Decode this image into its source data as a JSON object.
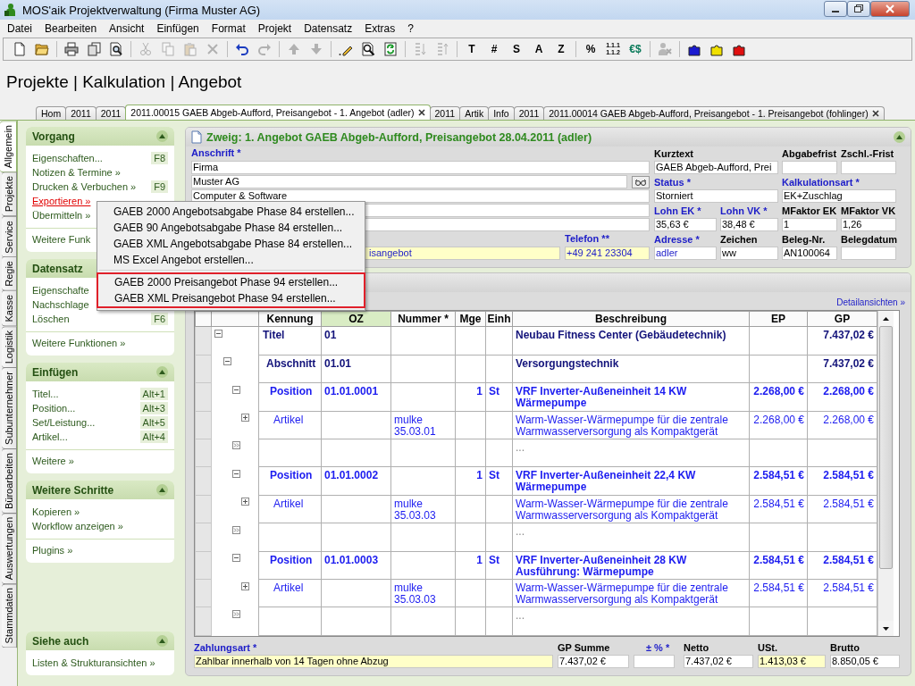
{
  "window": {
    "title": "MOS'aik Projektverwaltung (Firma Muster AG)"
  },
  "menu": [
    "Datei",
    "Bearbeiten",
    "Ansicht",
    "Einfügen",
    "Format",
    "Projekt",
    "Datensatz",
    "Extras",
    "?"
  ],
  "toolbar": [
    [
      {
        "kind": "icon",
        "disabled": false
      },
      {
        "kind": "icon",
        "disabled": false
      }
    ],
    [
      {
        "kind": "icon",
        "disabled": false
      },
      {
        "kind": "icon",
        "disabled": false
      },
      {
        "kind": "icon",
        "disabled": false
      }
    ],
    [
      {
        "kind": "icon",
        "disabled": true
      },
      {
        "kind": "icon",
        "disabled": true
      },
      {
        "kind": "icon",
        "disabled": true
      },
      {
        "kind": "icon",
        "disabled": true
      }
    ],
    [
      {
        "kind": "icon",
        "disabled": false
      },
      {
        "kind": "icon",
        "disabled": true
      }
    ],
    [
      {
        "kind": "icon",
        "disabled": true
      },
      {
        "kind": "icon",
        "disabled": true
      }
    ],
    [
      {
        "kind": "icon",
        "disabled": false
      },
      {
        "kind": "icon",
        "disabled": false
      },
      {
        "kind": "icon",
        "disabled": false
      }
    ],
    [
      {
        "kind": "icon",
        "disabled": true
      },
      {
        "kind": "icon",
        "disabled": true
      }
    ],
    [
      {
        "kind": "text",
        "label": "T"
      },
      {
        "kind": "text",
        "label": "#"
      },
      {
        "kind": "text",
        "label": "S"
      },
      {
        "kind": "text",
        "label": "A"
      },
      {
        "kind": "text",
        "label": "Z"
      }
    ],
    [
      {
        "kind": "text",
        "label": "%"
      },
      {
        "kind": "stack",
        "lines": [
          "1.1.1",
          "1.1.2"
        ]
      },
      {
        "kind": "currency",
        "label": "€$"
      }
    ],
    [
      {
        "kind": "icon",
        "disabled": true
      }
    ],
    [
      {
        "kind": "puzzle",
        "color": "#1a1ad0"
      },
      {
        "kind": "puzzle",
        "color": "#f0e000"
      },
      {
        "kind": "puzzle",
        "color": "#e01010"
      }
    ]
  ],
  "breadcrumb": "Projekte | Kalkulation | Angebot",
  "doc_tabs": [
    {
      "label": "Hom",
      "selected": false,
      "closable": false
    },
    {
      "label": "2011",
      "selected": false,
      "closable": false
    },
    {
      "label": "2011",
      "selected": false,
      "closable": false
    },
    {
      "label": "2011.00015 GAEB Abgeb-Aufford, Preisangebot - 1. Angebot (adler)",
      "selected": true,
      "closable": true
    },
    {
      "label": "2011",
      "selected": false,
      "closable": false
    },
    {
      "label": "Artik",
      "selected": false,
      "closable": false
    },
    {
      "label": "Info",
      "selected": false,
      "closable": false
    },
    {
      "label": "2011",
      "selected": false,
      "closable": false
    },
    {
      "label": "2011.00014 GAEB Abgeb-Aufford, Preisangebot - 1. Preisangebot (fohlinger)",
      "selected": false,
      "closable": true
    }
  ],
  "side_tabs": [
    {
      "label": "Allgemein",
      "selected": true
    },
    {
      "label": "Projekte",
      "selected": false
    },
    {
      "label": "Service",
      "selected": false
    },
    {
      "label": "Regie",
      "selected": false
    },
    {
      "label": "Kasse",
      "selected": false
    },
    {
      "label": "Logistik",
      "selected": false
    },
    {
      "label": "Subunternehmer",
      "selected": false
    },
    {
      "label": "Büroarbeiten",
      "selected": false
    },
    {
      "label": "Auswertungen",
      "selected": false
    },
    {
      "label": "Stammdaten",
      "selected": false
    }
  ],
  "sidebar": [
    {
      "title": "Vorgang",
      "collapse_button": true,
      "items": [
        {
          "label": "Eigenschaften...",
          "shortcut": "F8",
          "highlighted": false
        },
        {
          "label": "Notizen & Termine »",
          "highlighted": false
        },
        {
          "label": "Drucken & Verbuchen »",
          "shortcut": "F9",
          "highlighted": false
        },
        {
          "label": "Exportieren »",
          "highlighted": true
        },
        {
          "label": "Übermitteln »",
          "highlighted": false
        }
      ],
      "extra": [
        "Weitere Funk"
      ]
    },
    {
      "title": "Datensatz",
      "collapse_button": false,
      "items": [
        {
          "label": "Eigenschafte",
          "highlighted": false
        },
        {
          "label": "Nachschlage",
          "highlighted": false
        },
        {
          "label": "Löschen",
          "shortcut": "F6",
          "highlighted": false
        }
      ],
      "extra": [
        "Weitere Funktionen »"
      ]
    },
    {
      "title": "Einfügen",
      "collapse_button": true,
      "items": [
        {
          "label": "Titel...",
          "shortcut": "Alt+1",
          "highlighted": false
        },
        {
          "label": "Position...",
          "shortcut": "Alt+3",
          "highlighted": false
        },
        {
          "label": "Set/Leistung...",
          "shortcut": "Alt+5",
          "highlighted": false
        },
        {
          "label": "Artikel...",
          "shortcut": "Alt+4",
          "highlighted": false
        }
      ],
      "extra": [
        "Weitere »"
      ]
    },
    {
      "title": "Weitere Schritte",
      "collapse_button": true,
      "items": [
        {
          "label": "Kopieren »",
          "highlighted": false
        },
        {
          "label": "Workflow anzeigen »",
          "highlighted": false
        }
      ],
      "extra": [
        "Plugins »"
      ]
    },
    {
      "title": "Siehe auch",
      "collapse_button": true,
      "items": [
        {
          "label": "Listen & Strukturansichten »",
          "highlighted": false
        }
      ]
    }
  ],
  "branch": {
    "title": "Zweig: 1. Angebot GAEB Abgeb-Aufford, Preisangebot 28.04.2011 (adler)",
    "address_label": {
      "label": "Anschrift *",
      "required": true
    },
    "address_lines": [
      {
        "kind": "plain",
        "value": "Firma"
      },
      {
        "kind": "with-button",
        "value": "Muster AG"
      },
      {
        "kind": "plain",
        "value": "Computer & Software"
      },
      {
        "kind": "plain"
      },
      {
        "kind": "plain"
      }
    ],
    "contact": [
      {
        "value": "isangebot",
        "highlighted": true,
        "link": true
      },
      {
        "label": "Telefon **",
        "required": true,
        "value": "+49 241 23304",
        "highlighted": true,
        "link": true
      }
    ],
    "details": [
      [
        {
          "label": "Kurztext",
          "required": false,
          "value": "GAEB Abgeb-Aufford, Prei",
          "highlighted": false,
          "link": false
        },
        {
          "label": "Abgabefrist",
          "required": false,
          "highlighted": false
        },
        {
          "label": "Zschl.-Frist",
          "required": false,
          "highlighted": false
        }
      ],
      [
        {
          "label": "Status *",
          "required": true,
          "value": "Storniert",
          "highlighted": false,
          "link": false
        },
        {
          "label": "Kalkulationsart *",
          "required": true,
          "value": "EK+Zuschlag",
          "highlighted": false,
          "link": false
        }
      ],
      [
        {
          "label": "Lohn EK *",
          "required": true,
          "value": "35,63 €",
          "highlighted": false,
          "link": false
        },
        {
          "label": "Lohn VK *",
          "required": true,
          "value": "38,48 €",
          "highlighted": false,
          "link": false
        },
        {
          "label": "MFaktor EK",
          "required": false,
          "value": "1",
          "highlighted": false,
          "link": false
        },
        {
          "label": "MFaktor VK",
          "required": false,
          "value": "1,26",
          "highlighted": false,
          "link": false
        }
      ],
      [
        {
          "label": "Adresse *",
          "required": true,
          "value": "adler",
          "highlighted": false,
          "link": true
        },
        {
          "label": "Zeichen",
          "required": false,
          "value": "ww",
          "highlighted": false,
          "link": false
        },
        {
          "label": "Beleg-Nr.",
          "required": false,
          "value": "AN100064",
          "highlighted": false,
          "link": false
        },
        {
          "label": "Belegdatum",
          "required": false,
          "highlighted": false
        }
      ]
    ]
  },
  "positions": {
    "link": "Detailansichten »",
    "columns": [
      {
        "label": "Kennung",
        "sorted": false
      },
      {
        "label": "OZ",
        "sorted": true
      },
      {
        "label": "Nummer *",
        "sorted": false
      },
      {
        "label": "Mge",
        "sorted": false
      },
      {
        "label": "Einh",
        "sorted": false
      },
      {
        "label": "Beschreibung",
        "sorted": false
      },
      {
        "label": "EP",
        "sorted": false
      },
      {
        "label": "GP",
        "sorted": false
      }
    ],
    "rows": [
      {
        "kind": "title",
        "expanded": true,
        "kennung": "Titel",
        "oz": "01",
        "beschreibung": "Neubau Fitness Center (Gebäudetechnik)",
        "gp": "7.437,02 €",
        "children": [
          {
            "kind": "section",
            "expanded": true,
            "kennung": "Abschnitt",
            "oz": "01.01",
            "beschreibung": "Versorgungstechnik",
            "gp": "7.437,02 €",
            "children": [
              {
                "kind": "position",
                "expanded": true,
                "kennung": "Position",
                "oz": "01.01.0001",
                "mge": "1",
                "einh": "St",
                "beschreibung": "VRF Inverter-Außeneinheit 14 KW Wärmepumpe",
                "ep": "2.268,00 €",
                "gp": "2.268,00 €",
                "children": [
                  {
                    "kind": "article",
                    "expanded": false,
                    "kennung": "Artikel",
                    "nummer": "mulke\n35.03.01",
                    "beschreibung": "Warm-Wasser-Wärmepumpe für die zentrale Warmwasserversorgung als Kompaktgerät",
                    "ep": "2.268,00 €",
                    "gp": "2.268,00 €"
                  }
                ]
              },
              {
                "kind": "more",
                "beschreibung": "..."
              },
              {
                "kind": "position",
                "expanded": true,
                "kennung": "Position",
                "oz": "01.01.0002",
                "mge": "1",
                "einh": "St",
                "beschreibung": "VRF Inverter-Außeneinheit 22,4 KW Wärmepumpe",
                "ep": "2.584,51 €",
                "gp": "2.584,51 €",
                "children": [
                  {
                    "kind": "article",
                    "expanded": false,
                    "kennung": "Artikel",
                    "nummer": "mulke\n35.03.03",
                    "beschreibung": "Warm-Wasser-Wärmepumpe für die zentrale Warmwasserversorgung als Kompaktgerät",
                    "ep": "2.584,51 €",
                    "gp": "2.584,51 €"
                  }
                ]
              },
              {
                "kind": "more",
                "beschreibung": "..."
              },
              {
                "kind": "position",
                "expanded": true,
                "kennung": "Position",
                "oz": "01.01.0003",
                "mge": "1",
                "einh": "St",
                "beschreibung": "VRF Inverter-Außeneinheit 28 KW Ausführung: Wärmepumpe",
                "ep": "2.584,51 €",
                "gp": "2.584,51 €",
                "children": [
                  {
                    "kind": "article",
                    "expanded": false,
                    "kennung": "Artikel",
                    "nummer": "mulke\n35.03.03",
                    "beschreibung": "Warm-Wasser-Wärmepumpe für die zentrale Warmwasserversorgung als Kompaktgerät",
                    "ep": "2.584,51 €",
                    "gp": "2.584,51 €"
                  }
                ]
              },
              {
                "kind": "more",
                "beschreibung": "..."
              }
            ]
          }
        ]
      }
    ],
    "payment": {
      "label": "Zahlungsart *",
      "required": true,
      "value": "Zahlbar innerhalb von 14 Tagen ohne Abzug",
      "highlighted": true
    },
    "totals": [
      {
        "label": "GP Summe",
        "required": false,
        "value": "7.437,02 €",
        "highlighted": false
      },
      {
        "label": "± % *",
        "required": true,
        "highlighted": false
      },
      {
        "label": "Netto",
        "required": false,
        "value": "7.437,02 €",
        "highlighted": false
      },
      {
        "label": "USt.",
        "required": false,
        "value": "1.413,03 €",
        "highlighted": true
      },
      {
        "label": "Brutto",
        "required": false,
        "value": "8.850,05 €",
        "highlighted": false
      }
    ]
  },
  "context_menu": {
    "groups": [
      {
        "framed": false,
        "items": [
          "GAEB 2000 Angebotsabgabe Phase 84 erstellen...",
          "GAEB 90 Angebotsabgabe Phase 84 erstellen...",
          "GAEB XML Angebotsabgabe Phase 84 erstellen...",
          "MS Excel Angebot erstellen..."
        ]
      },
      {
        "framed": true,
        "items": [
          "GAEB 2000 Preisangebot Phase 94 erstellen...",
          "GAEB XML Preisangebot Phase 94 erstellen..."
        ]
      }
    ]
  }
}
